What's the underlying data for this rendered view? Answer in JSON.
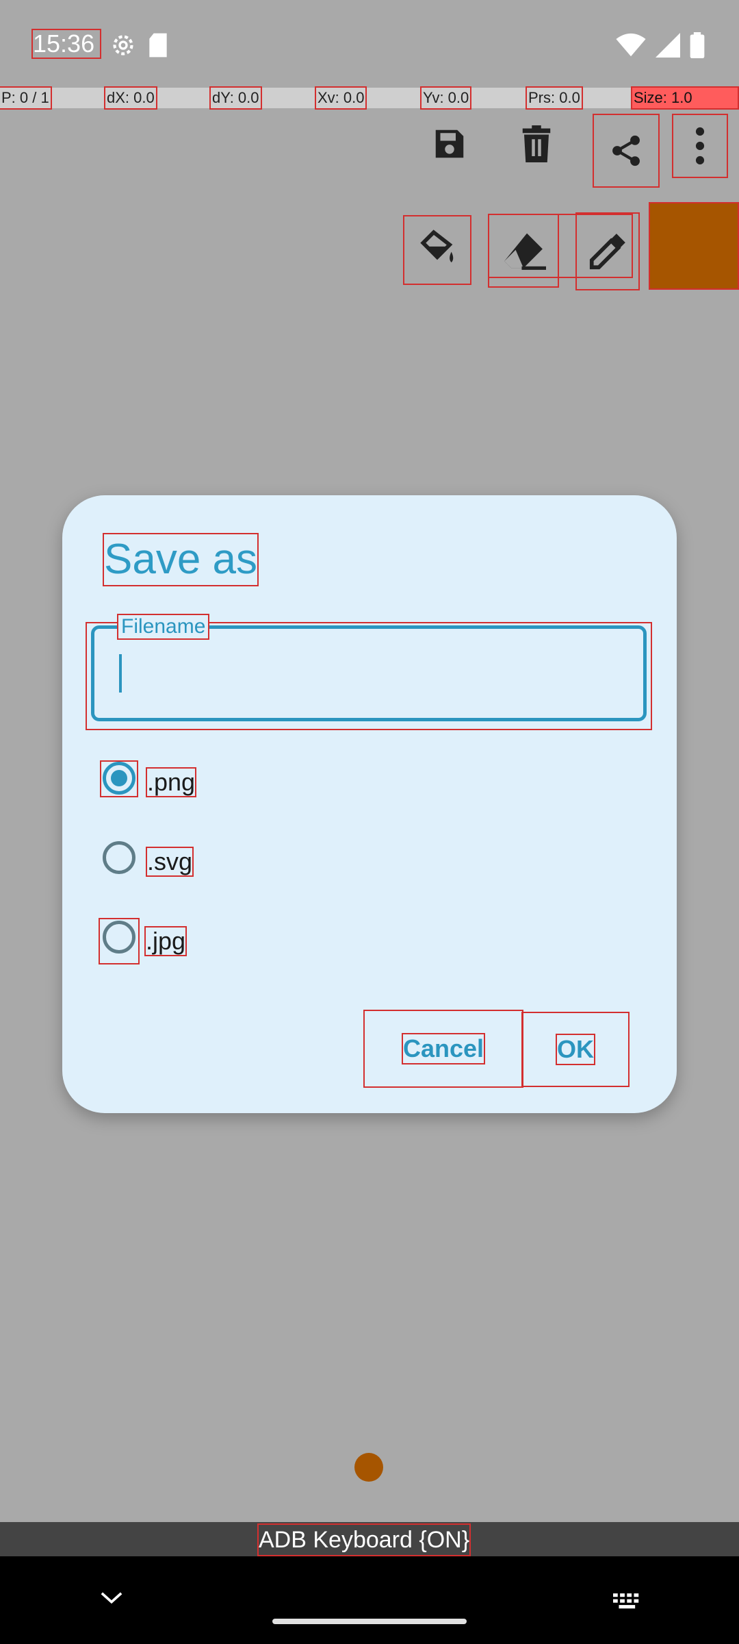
{
  "status": {
    "time": "15:36"
  },
  "pointer_info": {
    "p": "P: 0 / 1",
    "dx": "dX: 0.0",
    "dy": "dY: 0.0",
    "xv": "Xv: 0.0",
    "yv": "Yv: 0.0",
    "prs": "Prs: 0.0",
    "size": "Size: 1.0"
  },
  "toolbar": {
    "icons": [
      "save-icon",
      "delete-icon",
      "share-icon",
      "more-options-icon"
    ]
  },
  "tools": {
    "icons": [
      "fill-bucket-icon",
      "eraser-icon",
      "eyedropper-icon"
    ],
    "color_swatch": "#a65500"
  },
  "dialog": {
    "title": "Save as",
    "filename_label": "Filename",
    "filename_value": "",
    "options": [
      {
        "label": ".png",
        "checked": true
      },
      {
        "label": ".svg",
        "checked": false
      },
      {
        "label": ".jpg",
        "checked": false
      }
    ],
    "cancel_label": "Cancel",
    "ok_label": "OK"
  },
  "canvas": {
    "brush_color": "#a65500"
  },
  "keyboard": {
    "ime_label": "ADB Keyboard {ON}"
  },
  "colors": {
    "accent": "#2b95bf",
    "dialog_bg": "#dff0fb",
    "background": "#a9a9a9"
  }
}
